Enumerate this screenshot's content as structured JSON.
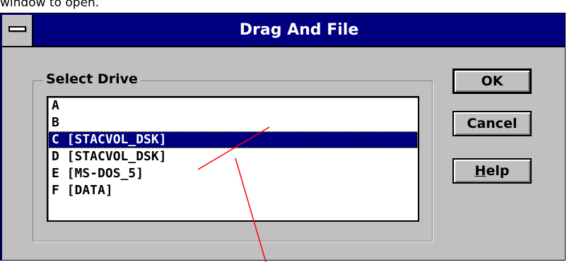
{
  "caption": "window to open.",
  "dialog": {
    "title": "Drag And File",
    "group_label": "Select Drive",
    "drives": [
      {
        "label": "A",
        "selected": false
      },
      {
        "label": "B",
        "selected": false
      },
      {
        "label": "C [STACVOL_DSK]",
        "selected": true
      },
      {
        "label": "D [STACVOL_DSK]",
        "selected": false
      },
      {
        "label": "E [MS-DOS_5]",
        "selected": false
      },
      {
        "label": "F [DATA]",
        "selected": false
      }
    ],
    "buttons": {
      "ok": "OK",
      "cancel": "Cancel",
      "help_mnemonic": "H",
      "help_rest": "elp"
    }
  },
  "colors": {
    "titlebar": "#000080",
    "face": "#c0c0c0",
    "selection": "#000080",
    "annotation": "#ff0000"
  },
  "icons": {
    "system_menu": "system-menu-icon"
  }
}
